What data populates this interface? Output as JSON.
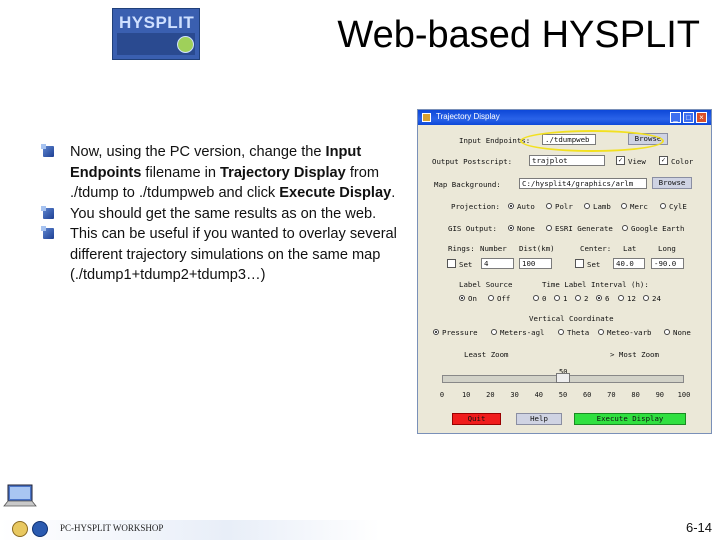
{
  "logo": {
    "text": "HYSPLIT"
  },
  "slide": {
    "title": "Web-based HYSPLIT",
    "footer_text": "PC-HYSPLIT WORKSHOP",
    "page_number": "6-14"
  },
  "bullets": [
    {
      "parts": [
        "Now, using the PC version, change the ",
        "Input Endpoints",
        " filename in ",
        "Trajectory Display",
        " from ./tdump to ./tdumpweb and click ",
        "Execute Display",
        "."
      ]
    },
    {
      "text": "You should get the same results as on the web."
    },
    {
      "text": "This can be useful if you wanted to overlay several different trajectory simulations on the same map (./tdump1+tdump2+tdump3…)"
    }
  ],
  "dialog": {
    "title": "Trajectory Display",
    "input_endpoints_label": "Input Endpoints:",
    "input_endpoints_value": "./tdumpweb",
    "browse_label": "Browse",
    "output_postscript_label": "Output Postscript:",
    "output_postscript_value": "trajplot",
    "view_label": "View",
    "color_label": "Color",
    "map_background_label": "Map Background:",
    "map_background_value": "C:/hysplit4/graphics/arlm",
    "projection_label": "Projection:",
    "projection_options": [
      "Auto",
      "Polr",
      "Lamb",
      "Merc",
      "CylE"
    ],
    "projection_selected": "Auto",
    "gis_label": "GIS Output:",
    "gis_options": [
      "None",
      "ESRI Generate",
      "Google Earth"
    ],
    "gis_selected": "None",
    "rings_label": "Rings:",
    "number_label": "Number",
    "dist_label": "Dist(km)",
    "center_label": "Center:",
    "lat_label": "Lat",
    "long_label": "Long",
    "set_label": "Set",
    "rings_number": "4",
    "rings_dist": "100",
    "center_lat": "40.0",
    "center_long": "-90.0",
    "label_source_label": "Label Source",
    "label_source_options": [
      "On",
      "Off"
    ],
    "label_source_selected": "On",
    "time_interval_label": "Time Label Interval (h):",
    "time_interval_options": [
      "0",
      "1",
      "2",
      "6",
      "12",
      "24"
    ],
    "time_interval_selected": "6",
    "vertical_label": "Vertical Coordinate",
    "vertical_options": [
      "Pressure",
      "Meters-agl",
      "Theta",
      "Meteo-varb",
      "None"
    ],
    "vertical_selected": "Pressure",
    "zoom_least": "Least Zoom",
    "zoom_most": "Most Zoom",
    "zoom_value": 50,
    "zoom_value_text": "50",
    "zoom_scale": [
      "0",
      "10",
      "20",
      "30",
      "40",
      "50",
      "60",
      "70",
      "80",
      "90",
      "100"
    ],
    "quit_label": "Quit",
    "help_label": "Help",
    "execute_label": "Execute Display"
  },
  "colors": {
    "titlebar": "#0d48d8",
    "dialog_bg": "#ebe8d8",
    "quit": "#f01c1c",
    "execute": "#30e040",
    "highlight": "#f2e020"
  }
}
